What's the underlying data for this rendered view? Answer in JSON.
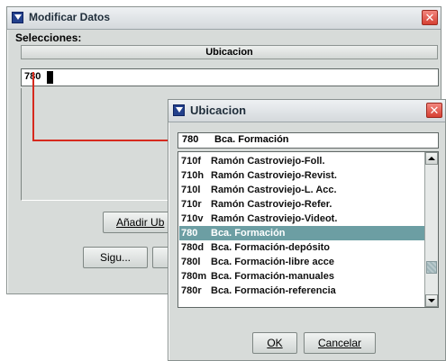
{
  "main_window": {
    "title": "Modificar Datos",
    "close_glyph": "✕",
    "selecciones_label": "Selecciones:",
    "column_header": "Ubicacion",
    "input_value": "780",
    "add_button_label": "Añadir Ub",
    "next_button_label": "Sigu...",
    "title_icon": "app-window-icon"
  },
  "dialog": {
    "title": "Ubicacion",
    "close_glyph": "✕",
    "title_icon": "app-window-icon",
    "field": {
      "code": "780",
      "name": "Bca. Formación"
    },
    "items": [
      {
        "code": "710f",
        "name": "Ramón Castroviejo-Foll.",
        "selected": false
      },
      {
        "code": "710h",
        "name": "Ramón Castroviejo-Revist.",
        "selected": false
      },
      {
        "code": "710l",
        "name": "Ramón Castroviejo-L. Acc.",
        "selected": false
      },
      {
        "code": "710r",
        "name": "Ramón Castroviejo-Refer.",
        "selected": false
      },
      {
        "code": "710v",
        "name": "Ramón Castroviejo-Videot.",
        "selected": false
      },
      {
        "code": "780",
        "name": "Bca. Formación",
        "selected": true
      },
      {
        "code": "780d",
        "name": "Bca. Formación-depósito",
        "selected": false
      },
      {
        "code": "780l",
        "name": "Bca. Formación-libre acce",
        "selected": false
      },
      {
        "code": "780m",
        "name": "Bca. Formación-manuales",
        "selected": false
      },
      {
        "code": "780r",
        "name": "Bca. Formación-referencia",
        "selected": false
      }
    ],
    "ok_label": "OK",
    "cancel_label": "Cancelar"
  },
  "colors": {
    "connector_line": "#d62a1e",
    "selection": "#6c9ea3",
    "window_bg": "#d7dbd9"
  }
}
